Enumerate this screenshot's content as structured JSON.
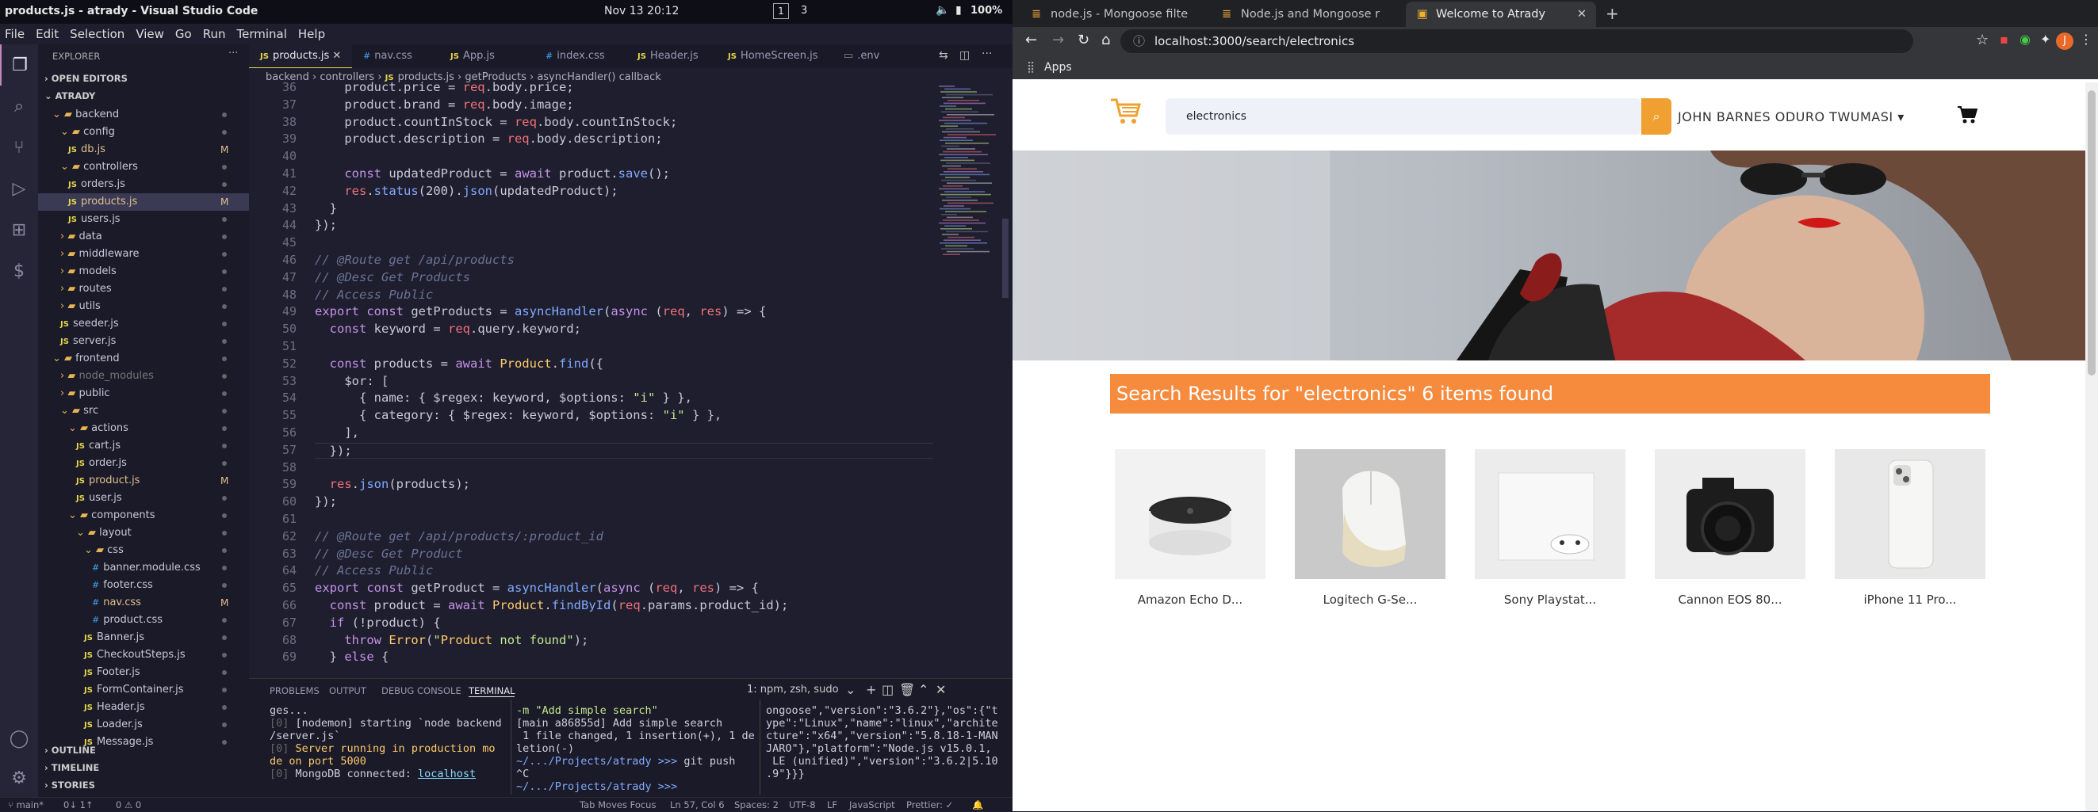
{
  "system": {
    "title": "products.js - atrady - Visual Studio Code",
    "menu": [
      "File",
      "Edit",
      "Selection",
      "View",
      "Go",
      "Run",
      "Terminal",
      "Help"
    ],
    "clock": "Nov 13  20:12",
    "workspace": "1",
    "battery": "100%",
    "updates": "3"
  },
  "explorer": {
    "header": "EXPLORER",
    "open_editors": "OPEN EDITORS",
    "root": "ATRADY",
    "rows": [
      {
        "label": "backend",
        "kind": "folder",
        "indent": 1,
        "open": true
      },
      {
        "label": "config",
        "kind": "folder",
        "indent": 2,
        "open": true
      },
      {
        "label": "db.js",
        "kind": "js",
        "indent": 3,
        "mark": "M"
      },
      {
        "label": "controllers",
        "kind": "folder",
        "indent": 2,
        "open": true
      },
      {
        "label": "orders.js",
        "kind": "js",
        "indent": 3
      },
      {
        "label": "products.js",
        "kind": "js",
        "indent": 3,
        "mark": "M",
        "selected": true
      },
      {
        "label": "users.js",
        "kind": "js",
        "indent": 3
      },
      {
        "label": "data",
        "kind": "folder",
        "indent": 2
      },
      {
        "label": "middleware",
        "kind": "folder",
        "indent": 2
      },
      {
        "label": "models",
        "kind": "folder",
        "indent": 2
      },
      {
        "label": "routes",
        "kind": "folder",
        "indent": 2
      },
      {
        "label": "utils",
        "kind": "folder",
        "indent": 2
      },
      {
        "label": "seeder.js",
        "kind": "js",
        "indent": 2
      },
      {
        "label": "server.js",
        "kind": "js",
        "indent": 2
      },
      {
        "label": "frontend",
        "kind": "folder",
        "indent": 1,
        "open": true
      },
      {
        "label": "node_modules",
        "kind": "folder",
        "indent": 2,
        "dim": true
      },
      {
        "label": "public",
        "kind": "folder",
        "indent": 2
      },
      {
        "label": "src",
        "kind": "folder",
        "indent": 2,
        "open": true
      },
      {
        "label": "actions",
        "kind": "folder",
        "indent": 3,
        "open": true
      },
      {
        "label": "cart.js",
        "kind": "js",
        "indent": 4
      },
      {
        "label": "order.js",
        "kind": "js",
        "indent": 4
      },
      {
        "label": "product.js",
        "kind": "js",
        "indent": 4,
        "mark": "M"
      },
      {
        "label": "user.js",
        "kind": "js",
        "indent": 4
      },
      {
        "label": "components",
        "kind": "folder",
        "indent": 3,
        "open": true
      },
      {
        "label": "layout",
        "kind": "folder",
        "indent": 4,
        "open": true
      },
      {
        "label": "css",
        "kind": "folder",
        "indent": 5,
        "open": true
      },
      {
        "label": "banner.module.css",
        "kind": "css",
        "indent": 6
      },
      {
        "label": "footer.css",
        "kind": "css",
        "indent": 6
      },
      {
        "label": "nav.css",
        "kind": "css",
        "indent": 6,
        "mark": "M"
      },
      {
        "label": "product.css",
        "kind": "css",
        "indent": 6
      },
      {
        "label": "Banner.js",
        "kind": "js",
        "indent": 5
      },
      {
        "label": "CheckoutSteps.js",
        "kind": "js",
        "indent": 5
      },
      {
        "label": "Footer.js",
        "kind": "js",
        "indent": 5
      },
      {
        "label": "FormContainer.js",
        "kind": "js",
        "indent": 5
      },
      {
        "label": "Header.js",
        "kind": "js",
        "indent": 5
      },
      {
        "label": "Loader.js",
        "kind": "js",
        "indent": 5
      },
      {
        "label": "Message.js",
        "kind": "js",
        "indent": 5
      }
    ],
    "outline": "OUTLINE",
    "timeline": "TIMELINE",
    "stories": "STORIES"
  },
  "tabs": [
    "products.js",
    "nav.css",
    "App.js",
    "index.css",
    "Header.js",
    "HomeScreen.js",
    ".env"
  ],
  "breadcrumb": [
    "backend",
    "controllers",
    "products.js",
    "getProducts",
    "asyncHandler() callback"
  ],
  "code": {
    "start": 36,
    "lines": [
      "    product.price = req.body.price;",
      "    product.brand = req.body.image;",
      "    product.countInStock = req.body.countInStock;",
      "    product.description = req.body.description;",
      "",
      "    const updatedProduct = await product.save();",
      "    res.status(200).json(updatedProduct);",
      "  }",
      "});",
      "",
      "// @Route get /api/products",
      "// @Desc Get Products",
      "// Access Public",
      "export const getProducts = asyncHandler(async (req, res) => {",
      "  const keyword = req.query.keyword;",
      "",
      "  const products = await Product.find({",
      "    $or: [",
      "      { name: { $regex: keyword, $options: \"i\" } },",
      "      { category: { $regex: keyword, $options: \"i\" } },",
      "    ],",
      "  });",
      "",
      "  res.json(products);",
      "});",
      "",
      "// @Route get /api/products/:product_id",
      "// @Desc Get Product",
      "// Access Public",
      "export const getProduct = asyncHandler(async (req, res) => {",
      "  const product = await Product.findById(req.params.product_id);",
      "  if (!product) {",
      "    throw Error(\"Product not found\");",
      "  } else {"
    ]
  },
  "panel": {
    "tabs": [
      "PROBLEMS",
      "OUTPUT",
      "DEBUG CONSOLE",
      "TERMINAL"
    ],
    "terminal_select": "1: npm, zsh, sudo",
    "term1": [
      "ges...",
      "[0] [nodemon] starting `node backend",
      "/server.js`",
      "[0] Server running in production mo",
      "de on port 5000",
      "[0] MongoDB connected: localhost"
    ],
    "term2": [
      "-m \"Add simple search\"",
      "[main a86855d] Add simple search",
      " 1 file changed, 1 insertion(+), 1 de",
      "letion(-)",
      "~/.../Projects/atrady >>> git push",
      "^C",
      "~/.../Projects/atrady >>> "
    ],
    "term3": [
      "ongoose\",\"version\":\"3.6.2\"},\"os\":{\"t",
      "ype\":\"Linux\",\"name\":\"linux\",\"archite",
      "cture\":\"x64\",\"version\":\"5.8.18-1-MAN",
      "JARO\"},\"platform\":\"Node.js v15.0.1,",
      " LE (unified)\",\"version\":\"3.6.2|5.10",
      ".9\"}}}"
    ]
  },
  "status": {
    "branch": "main*",
    "sync": "0↓ 1↑",
    "problems": "0 ⚠ 0",
    "tab": "Tab Moves Focus",
    "pos": "Ln 57, Col 6",
    "spaces": "Spaces: 2",
    "enc": "UTF-8",
    "eol": "LF",
    "lang": "JavaScript",
    "prettier": "Prettier: ✓"
  },
  "browser": {
    "tabs": [
      "node.js - Mongoose filte",
      "Node.js and Mongoose r",
      "Welcome to Atrady"
    ],
    "url": "localhost:3000/search/electronics",
    "bookmarks": "Apps",
    "avatar": "J"
  },
  "shop": {
    "search_value": "electronics",
    "user": "JOHN BARNES ODURO TWUMASI",
    "results": "Search Results for \"electronics\" 6 items found",
    "products": [
      "Amazon Echo D...",
      "Logitech G-Se...",
      "Sony Playstat...",
      "Cannon EOS 80...",
      "iPhone 11 Pro..."
    ]
  }
}
